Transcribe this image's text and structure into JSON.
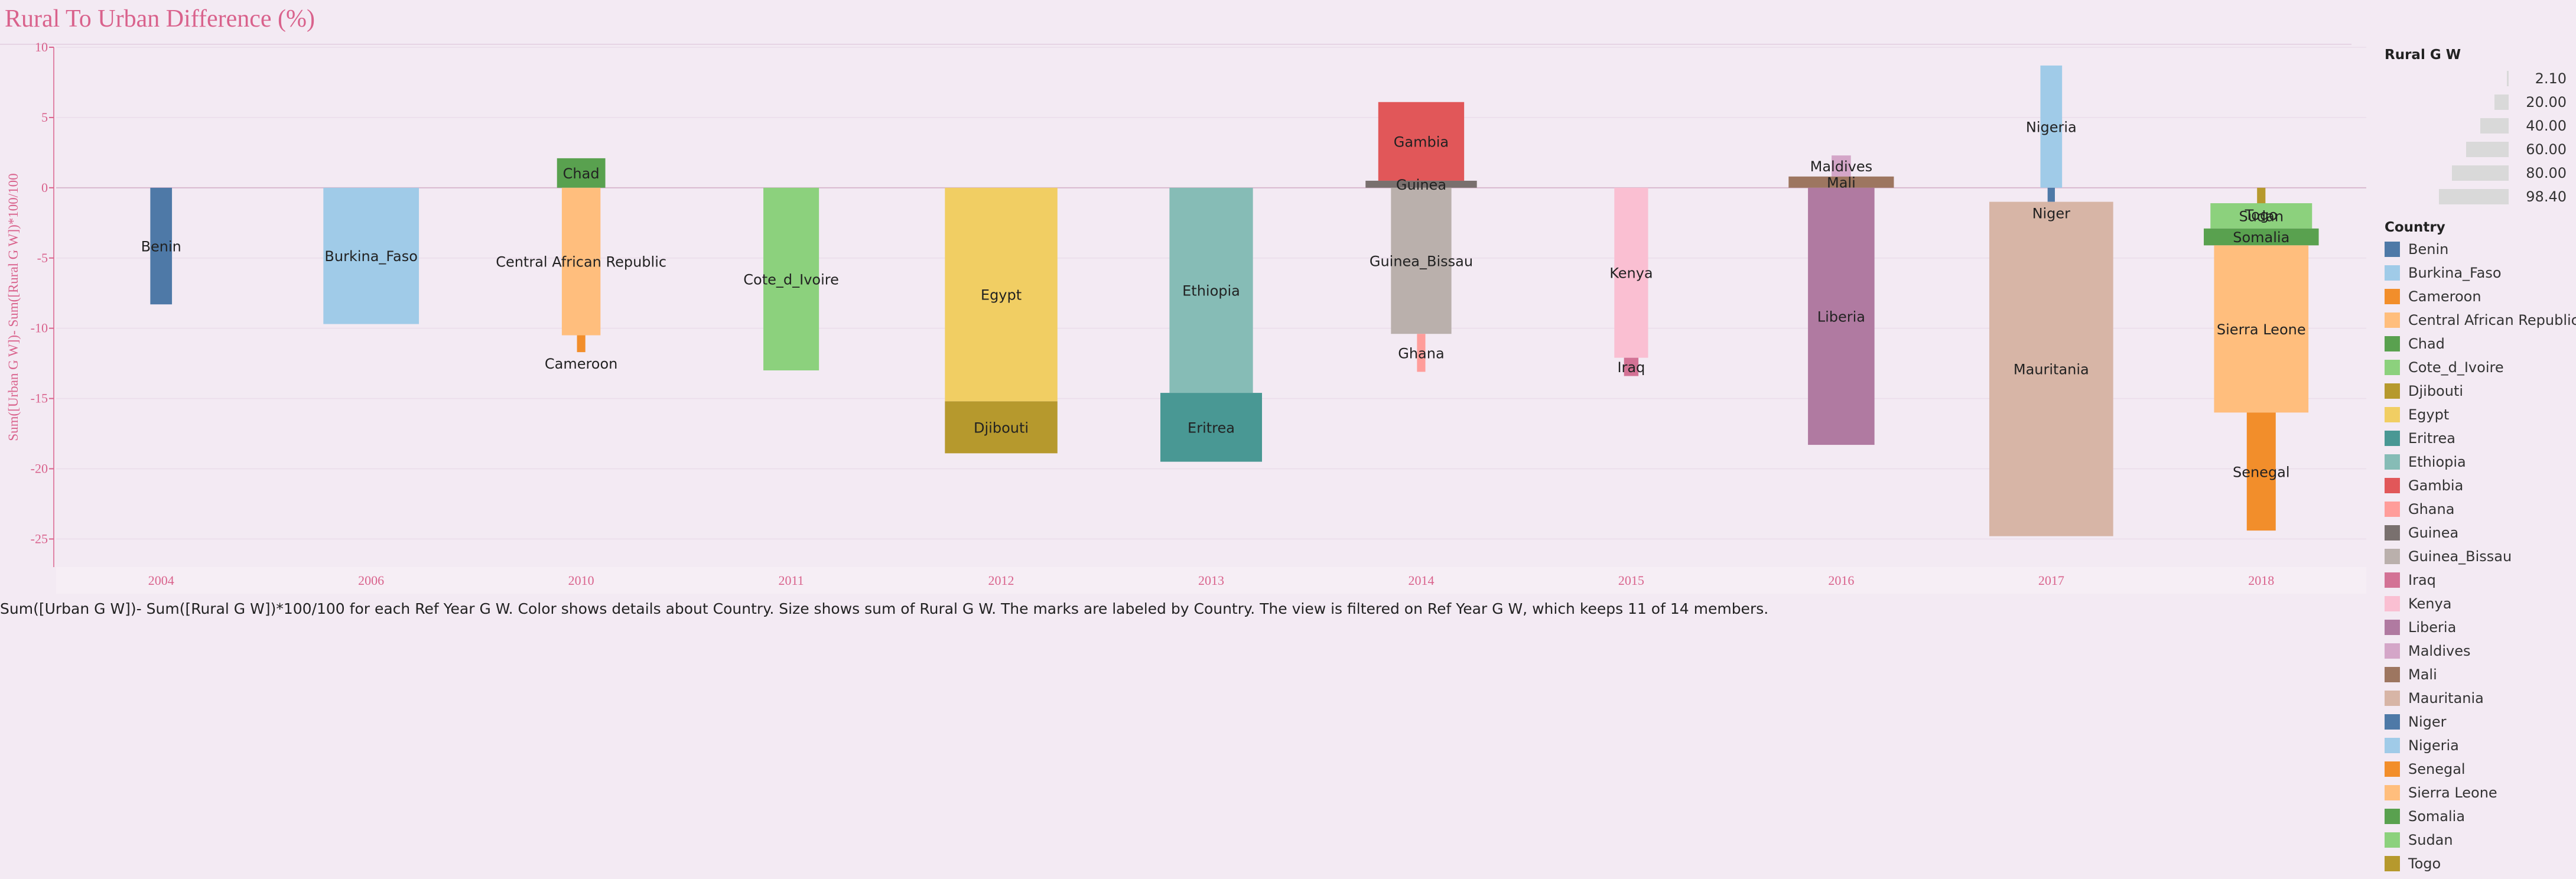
{
  "title": "Rural To Urban Difference (%)",
  "caption": "Sum([Urban G W])- Sum([Rural G W])*100/100 for each Ref Year G W.  Color shows details about Country.  Size shows sum of Rural G W.  The marks are labeled by Country. The view is filtered on Ref Year G W, which keeps 11 of 14 members.",
  "legend": {
    "size_title": "Rural G W",
    "size_items": [
      {
        "label": "2.10",
        "value": 2.1
      },
      {
        "label": "20.00",
        "value": 20
      },
      {
        "label": "40.00",
        "value": 40
      },
      {
        "label": "60.00",
        "value": 60
      },
      {
        "label": "80.00",
        "value": 80
      },
      {
        "label": "98.40",
        "value": 98.4
      }
    ],
    "color_title": "Country",
    "color_items": [
      {
        "name": "Benin",
        "color": "#4e79a7"
      },
      {
        "name": "Burkina_Faso",
        "color": "#a0cbe8"
      },
      {
        "name": "Cameroon",
        "color": "#f28e2b"
      },
      {
        "name": "Central African Republic",
        "color": "#ffbe7d"
      },
      {
        "name": "Chad",
        "color": "#59a14f"
      },
      {
        "name": "Cote_d_Ivoire",
        "color": "#8cd17d"
      },
      {
        "name": "Djibouti",
        "color": "#b6992d"
      },
      {
        "name": "Egypt",
        "color": "#f1ce63"
      },
      {
        "name": "Eritrea",
        "color": "#499894"
      },
      {
        "name": "Ethiopia",
        "color": "#86bcb6"
      },
      {
        "name": "Gambia",
        "color": "#e15759"
      },
      {
        "name": "Ghana",
        "color": "#ff9d9a"
      },
      {
        "name": "Guinea",
        "color": "#79706e"
      },
      {
        "name": "Guinea_Bissau",
        "color": "#bab0ac"
      },
      {
        "name": "Iraq",
        "color": "#d37295"
      },
      {
        "name": "Kenya",
        "color": "#fabfd2"
      },
      {
        "name": "Liberia",
        "color": "#b07aa1"
      },
      {
        "name": "Maldives",
        "color": "#d4a6c8"
      },
      {
        "name": "Mali",
        "color": "#9d7660"
      },
      {
        "name": "Mauritania",
        "color": "#d7b5a6"
      },
      {
        "name": "Niger",
        "color": "#4e79a7"
      },
      {
        "name": "Nigeria",
        "color": "#a0cbe8"
      },
      {
        "name": "Senegal",
        "color": "#f28e2b"
      },
      {
        "name": "Sierra Leone",
        "color": "#ffbe7d"
      },
      {
        "name": "Somalia",
        "color": "#59a14f"
      },
      {
        "name": "Sudan",
        "color": "#8cd17d"
      },
      {
        "name": "Togo",
        "color": "#b6992d"
      }
    ]
  },
  "chart_data": {
    "type": "bar",
    "ylabel": "Sum([Urban G W])- Sum([Rural G W])*100/100",
    "xlabel": "",
    "ylim": [
      -27,
      10
    ],
    "yticks": [
      10,
      5,
      0,
      -5,
      -10,
      -15,
      -20,
      -25
    ],
    "grid": true,
    "categories": [
      "2004",
      "2006",
      "2010",
      "2011",
      "2012",
      "2013",
      "2014",
      "2015",
      "2016",
      "2017",
      "2018"
    ],
    "marks": [
      {
        "year": "2004",
        "country": "Benin",
        "from": 0,
        "to": -8.3,
        "size": 14
      },
      {
        "year": "2006",
        "country": "Burkina_Faso",
        "from": 0,
        "to": -9.7,
        "size": 75
      },
      {
        "year": "2010",
        "country": "Chad",
        "from": 0,
        "to": 2.1,
        "size": 36
      },
      {
        "year": "2010",
        "country": "Central African Republic",
        "from": 0,
        "to": -10.5,
        "size": 28
      },
      {
        "year": "2010",
        "country": "Cameroon",
        "from": -10.5,
        "to": -11.7,
        "size": 3
      },
      {
        "year": "2011",
        "country": "Cote_d_Ivoire",
        "from": 0,
        "to": -13.0,
        "size": 42
      },
      {
        "year": "2012",
        "country": "Egypt",
        "from": 0,
        "to": -15.2,
        "size": 89
      },
      {
        "year": "2012",
        "country": "Djibouti",
        "from": -15.2,
        "to": -18.9,
        "size": 89
      },
      {
        "year": "2013",
        "country": "Ethiopia",
        "from": 0,
        "to": -14.6,
        "size": 65
      },
      {
        "year": "2013",
        "country": "Eritrea",
        "from": -14.6,
        "to": -19.5,
        "size": 80
      },
      {
        "year": "2014",
        "country": "Gambia",
        "from": 0.5,
        "to": 6.1,
        "size": 67
      },
      {
        "year": "2014",
        "country": "Guinea",
        "from": 0,
        "to": 0.5,
        "size": 88
      },
      {
        "year": "2014",
        "country": "Guinea_Bissau",
        "from": 0,
        "to": -10.4,
        "size": 46
      },
      {
        "year": "2014",
        "country": "Ghana",
        "from": -10.4,
        "to": -13.1,
        "size": 3
      },
      {
        "year": "2015",
        "country": "Kenya",
        "from": 0,
        "to": -12.1,
        "size": 24
      },
      {
        "year": "2015",
        "country": "Iraq",
        "from": -12.1,
        "to": -13.4,
        "size": 8
      },
      {
        "year": "2016",
        "country": "Maldives",
        "from": 0.8,
        "to": 2.3,
        "size": 12
      },
      {
        "year": "2016",
        "country": "Mali",
        "from": 0,
        "to": 0.8,
        "size": 83
      },
      {
        "year": "2016",
        "country": "Liberia",
        "from": 0,
        "to": -18.3,
        "size": 51
      },
      {
        "year": "2017",
        "country": "Nigeria",
        "from": 0,
        "to": 8.7,
        "size": 14
      },
      {
        "year": "2017",
        "country": "Niger",
        "from": 0,
        "to": -1.0,
        "size": 2.1
      },
      {
        "year": "2017",
        "country": "Mauritania",
        "from": -1.0,
        "to": -24.8,
        "size": 98.4
      },
      {
        "year": "2018",
        "country": "Togo",
        "from": 0,
        "to": -1.1,
        "size": 3
      },
      {
        "year": "2018",
        "country": "Sudan",
        "from": -1.1,
        "to": -2.9,
        "size": 80
      },
      {
        "year": "2018",
        "country": "Somalia",
        "from": -2.9,
        "to": -4.1,
        "size": 91
      },
      {
        "year": "2018",
        "country": "Sierra Leone",
        "from": -4.1,
        "to": -16.0,
        "size": 74
      },
      {
        "year": "2018",
        "country": "Senegal",
        "from": -16.0,
        "to": -24.4,
        "size": 20
      }
    ]
  }
}
